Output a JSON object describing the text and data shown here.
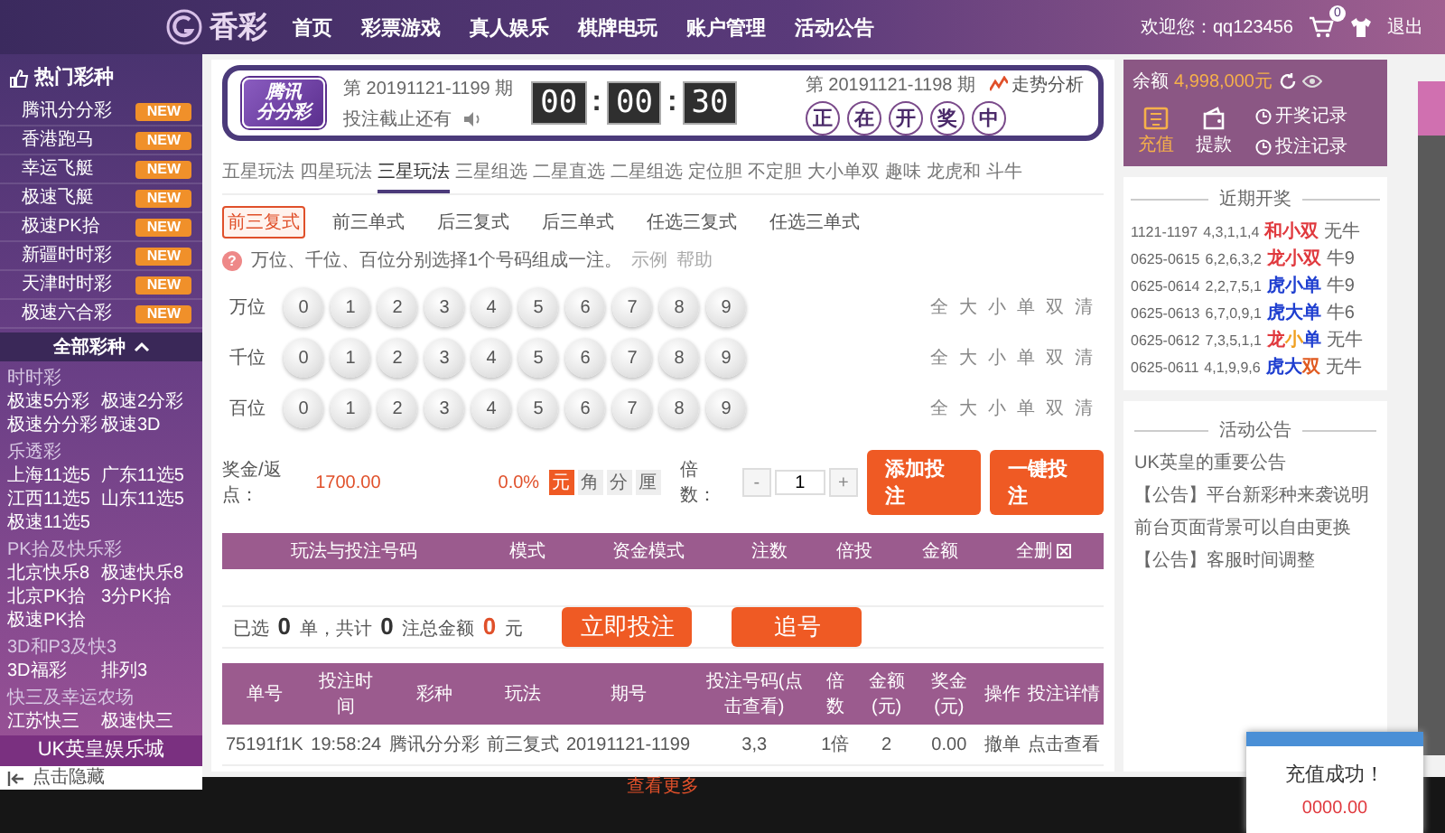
{
  "header": {
    "logo": "香彩",
    "nav": [
      "首页",
      "彩票游戏",
      "真人娱乐",
      "棋牌电玩",
      "账户管理",
      "活动公告"
    ],
    "welcome": "欢迎您：qq123456",
    "cart_count": "0",
    "logout": "退出"
  },
  "sidebar": {
    "title": "热门彩种",
    "hot": [
      {
        "name": "腾讯分分彩",
        "badge": "NEW"
      },
      {
        "name": "香港跑马",
        "badge": "NEW"
      },
      {
        "name": "幸运飞艇",
        "badge": "NEW"
      },
      {
        "name": "极速飞艇",
        "badge": "NEW"
      },
      {
        "name": "极速PK拾",
        "badge": "NEW"
      },
      {
        "name": "新疆时时彩",
        "badge": "NEW"
      },
      {
        "name": "天津时时彩",
        "badge": "NEW"
      },
      {
        "name": "极速六合彩",
        "badge": "NEW"
      }
    ],
    "all_label": "全部彩种",
    "expanded": true,
    "groups": [
      {
        "title": "时时彩",
        "items": [
          "极速5分彩",
          "极速2分彩",
          "极速分分彩",
          "极速3D"
        ]
      },
      {
        "title": "乐透彩",
        "items": [
          "上海11选5",
          "广东11选5",
          "江西11选5",
          "山东11选5",
          "极速11选5"
        ]
      },
      {
        "title": "PK拾及快乐彩",
        "items": [
          "北京快乐8",
          "极速快乐8",
          "北京PK拾",
          "3分PK拾",
          "极速PK拾"
        ]
      },
      {
        "title": "3D和P3及快3",
        "items": [
          "3D福彩",
          "排列3"
        ]
      },
      {
        "title": "快三及幸运农场",
        "items": [
          "江苏快三",
          "极速快三"
        ]
      }
    ],
    "promo": "UK英皇娱乐城",
    "hide": "点击隐藏"
  },
  "lottery": {
    "logo": [
      "腾讯",
      "分分彩"
    ],
    "current_issue": "第 20191121-1199 期",
    "deadline_label": "投注截止还有",
    "countdown": [
      {
        "kind": "digits",
        "text": "00"
      },
      {
        "kind": "sep",
        "text": ":"
      },
      {
        "kind": "digits",
        "text": "00"
      },
      {
        "kind": "sep",
        "text": ":"
      },
      {
        "kind": "digits",
        "text": "30"
      }
    ],
    "last_issue": "第 20191121-1198 期",
    "trend": "走势分析",
    "draw_status": [
      "正",
      "在",
      "开",
      "奖",
      "中"
    ]
  },
  "play_tabs": [
    {
      "label": "五星玩法",
      "selected": false
    },
    {
      "label": "四星玩法",
      "selected": false
    },
    {
      "label": "三星玩法",
      "selected": true
    },
    {
      "label": "三星组选",
      "selected": false
    },
    {
      "label": "二星直选",
      "selected": false
    },
    {
      "label": "二星组选",
      "selected": false
    },
    {
      "label": "定位胆",
      "selected": false
    },
    {
      "label": "不定胆",
      "selected": false
    },
    {
      "label": "大小单双",
      "selected": false
    },
    {
      "label": "趣味",
      "selected": false
    },
    {
      "label": "龙虎和",
      "selected": false
    },
    {
      "label": "斗牛",
      "selected": false
    }
  ],
  "sub_tabs": [
    {
      "label": "前三复式",
      "selected": true
    },
    {
      "label": "前三单式",
      "selected": false
    },
    {
      "label": "后三复式",
      "selected": false
    },
    {
      "label": "后三单式",
      "selected": false
    },
    {
      "label": "任选三复式",
      "selected": false
    },
    {
      "label": "任选三单式",
      "selected": false
    }
  ],
  "hint": {
    "icon": "?",
    "text": "万位、千位、百位分别选择1个号码组成一注。",
    "example": "示例",
    "help": "帮助"
  },
  "positions": [
    {
      "label": "万位",
      "balls": [
        {
          "n": "0",
          "selected": false
        },
        {
          "n": "1",
          "selected": false
        },
        {
          "n": "2",
          "selected": false
        },
        {
          "n": "3",
          "selected": false
        },
        {
          "n": "4",
          "selected": false
        },
        {
          "n": "5",
          "selected": false
        },
        {
          "n": "6",
          "selected": false
        },
        {
          "n": "7",
          "selected": false
        },
        {
          "n": "8",
          "selected": false
        },
        {
          "n": "9",
          "selected": false
        }
      ],
      "quick": [
        "全",
        "大",
        "小",
        "单",
        "双",
        "清"
      ]
    },
    {
      "label": "千位",
      "balls": [
        {
          "n": "0",
          "selected": false
        },
        {
          "n": "1",
          "selected": false
        },
        {
          "n": "2",
          "selected": false
        },
        {
          "n": "3",
          "selected": false
        },
        {
          "n": "4",
          "selected": false
        },
        {
          "n": "5",
          "selected": false
        },
        {
          "n": "6",
          "selected": false
        },
        {
          "n": "7",
          "selected": false
        },
        {
          "n": "8",
          "selected": false
        },
        {
          "n": "9",
          "selected": false
        }
      ],
      "quick": [
        "全",
        "大",
        "小",
        "单",
        "双",
        "清"
      ]
    },
    {
      "label": "百位",
      "balls": [
        {
          "n": "0",
          "selected": false
        },
        {
          "n": "1",
          "selected": false
        },
        {
          "n": "2",
          "selected": false
        },
        {
          "n": "3",
          "selected": false
        },
        {
          "n": "4",
          "selected": false
        },
        {
          "n": "5",
          "selected": false
        },
        {
          "n": "6",
          "selected": false
        },
        {
          "n": "7",
          "selected": false
        },
        {
          "n": "8",
          "selected": false
        },
        {
          "n": "9",
          "selected": false
        }
      ],
      "quick": [
        "全",
        "大",
        "小",
        "单",
        "双",
        "清"
      ]
    }
  ],
  "bet_bar": {
    "prize_label": "奖金/返点：",
    "prize": "1700.00",
    "rebate": "0.0%",
    "units": [
      {
        "label": "元",
        "selected": true
      },
      {
        "label": "角",
        "selected": false
      },
      {
        "label": "分",
        "selected": false
      },
      {
        "label": "厘",
        "selected": false
      }
    ],
    "multiple_label": "倍数：",
    "minus": "-",
    "multiple": "1",
    "plus": "+",
    "add": "添加投注",
    "quick_bet": "一键投注"
  },
  "cart": {
    "columns": [
      "玩法与投注号码",
      "模式",
      "资金模式",
      "注数",
      "倍投",
      "金额",
      "全删"
    ]
  },
  "summary": {
    "text": "已选 **0** 单，共计 **0** 注总金额 **0** 元",
    "bet_now": "立即投注",
    "chase": "追号"
  },
  "records": {
    "columns": [
      "单号",
      "投注时间",
      "彩种",
      "玩法",
      "期号",
      "投注号码(点击查看)",
      "倍数",
      "金额(元)",
      "奖金(元)",
      "操作",
      "投注详情"
    ],
    "rows": [
      [
        "75191f1K",
        "19:58:24",
        "腾讯分分彩",
        "前三复式",
        "20191121-1199",
        "3,3",
        "1倍",
        "2",
        "0.00",
        "撤单",
        "点击查看"
      ]
    ],
    "more": "查看更多"
  },
  "account": {
    "balance_label": "余额",
    "balance": "4,998,000元",
    "actions": [
      {
        "kind": "deposit",
        "label": "充值"
      },
      {
        "kind": "withdraw",
        "label": "提款"
      }
    ],
    "links": [
      "开奖记录",
      "投注记录"
    ]
  },
  "recent": {
    "title": "近期开奖",
    "rows": [
      {
        "issue": "1121-1197",
        "numbers": "4,3,1,1,4",
        "tags": [
          {
            "t": "和",
            "color": "#e0393e"
          },
          {
            "t": "小",
            "color": "#e0393e"
          },
          {
            "t": "双",
            "color": "#e0393e"
          }
        ],
        "niu": "无牛"
      },
      {
        "issue": "0625-0615",
        "numbers": "6,2,6,3,2",
        "tags": [
          {
            "t": "龙",
            "color": "#e0393e"
          },
          {
            "t": "小",
            "color": "#e0393e"
          },
          {
            "t": "双",
            "color": "#e0393e"
          }
        ],
        "niu": "牛9"
      },
      {
        "issue": "0625-0614",
        "numbers": "2,2,7,5,1",
        "tags": [
          {
            "t": "虎",
            "color": "#1f3fd0"
          },
          {
            "t": "小",
            "color": "#1f3fd0"
          },
          {
            "t": "单",
            "color": "#1f3fd0"
          }
        ],
        "niu": "牛9"
      },
      {
        "issue": "0625-0613",
        "numbers": "6,7,0,9,1",
        "tags": [
          {
            "t": "虎",
            "color": "#1f3fd0"
          },
          {
            "t": "大",
            "color": "#1f3fd0"
          },
          {
            "t": "单",
            "color": "#1f3fd0"
          }
        ],
        "niu": "牛6"
      },
      {
        "issue": "0625-0612",
        "numbers": "7,3,5,1,1",
        "tags": [
          {
            "t": "龙",
            "color": "#e0393e"
          },
          {
            "t": "小",
            "color": "#f0a020"
          },
          {
            "t": "单",
            "color": "#1f3fd0"
          }
        ],
        "niu": "无牛"
      },
      {
        "issue": "0625-0611",
        "numbers": "4,1,9,9,6",
        "tags": [
          {
            "t": "虎",
            "color": "#1f3fd0"
          },
          {
            "t": "大",
            "color": "#1f3fd0"
          },
          {
            "t": "双",
            "color": "#e05a20"
          }
        ],
        "niu": "无牛"
      }
    ]
  },
  "notices": {
    "title": "活动公告",
    "items": [
      "UK英皇的重要公告",
      "【公告】平台新彩种来袭说明",
      "前台页面背景可以自由更换",
      "【公告】客服时间调整"
    ]
  },
  "toast": {
    "title": "充值成功！",
    "amount": "0000.00"
  }
}
